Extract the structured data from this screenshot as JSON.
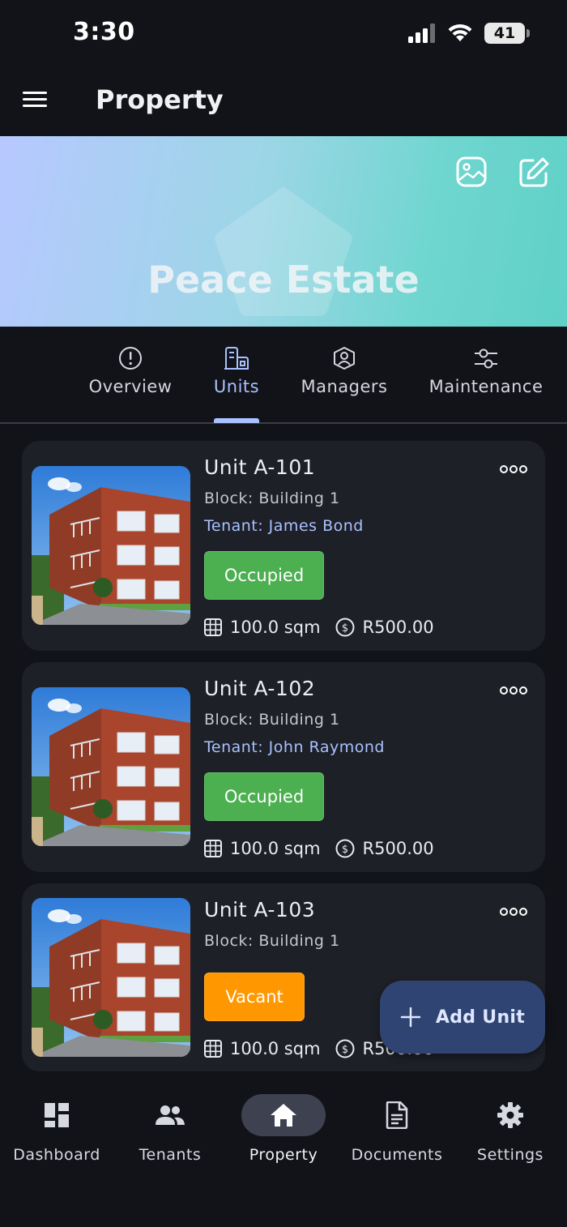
{
  "status_bar": {
    "time": "3:30",
    "battery": "41"
  },
  "app_bar": {
    "title": "Property"
  },
  "banner": {
    "property_name": "Peace Estate"
  },
  "tabs": [
    {
      "label": "Overview",
      "icon": "info-circle-icon"
    },
    {
      "label": "Units",
      "icon": "building-icon",
      "active": true
    },
    {
      "label": "Managers",
      "icon": "user-badge-icon"
    },
    {
      "label": "Maintenance",
      "icon": "sliders-icon"
    }
  ],
  "units": [
    {
      "name": "Unit A-101",
      "block": "Block: Building 1",
      "tenant": "Tenant: James Bond",
      "status": "Occupied",
      "area": "100.0 sqm",
      "rent": "R500.00"
    },
    {
      "name": "Unit A-102",
      "block": "Block: Building 1",
      "tenant": "Tenant: John Raymond",
      "status": "Occupied",
      "area": "100.0 sqm",
      "rent": "R500.00"
    },
    {
      "name": "Unit A-103",
      "block": "Block: Building 1",
      "tenant": "",
      "status": "Vacant",
      "area": "100.0 sqm",
      "rent": "R500.00"
    }
  ],
  "fab": {
    "label": "Add Unit"
  },
  "bottom_nav": [
    {
      "label": "Dashboard",
      "icon": "dashboard-icon"
    },
    {
      "label": "Tenants",
      "icon": "people-icon"
    },
    {
      "label": "Property",
      "icon": "home-icon",
      "active": true
    },
    {
      "label": "Documents",
      "icon": "document-icon"
    },
    {
      "label": "Settings",
      "icon": "gear-icon"
    }
  ],
  "colors": {
    "accent": "#a9c1ff",
    "occupied": "#4caf50",
    "vacant": "#ff9800",
    "fab": "#2f4472"
  }
}
